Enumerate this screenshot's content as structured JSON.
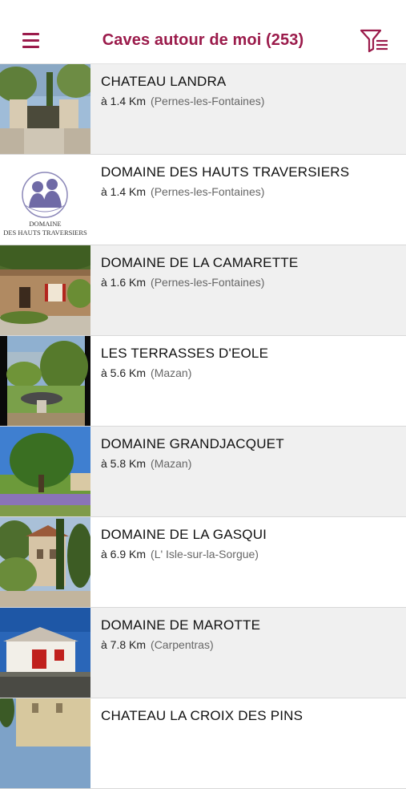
{
  "header": {
    "title": "Caves autour de moi (253)",
    "menu_icon": "hamburger-menu-icon",
    "filter_icon": "filter-list-icon",
    "accent_color": "#9b1b4b"
  },
  "wineries": [
    {
      "name": "CHATEAU LANDRA",
      "distance": "à 1.4 Km",
      "town": "(Pernes-les-Fontaines)",
      "thumb": "gate-photo"
    },
    {
      "name": "DOMAINE DES HAUTS TRAVERSIERS",
      "distance": "à 1.4 Km",
      "town": "(Pernes-les-Fontaines)",
      "thumb": "logo",
      "logo_line1": "DOMAINE",
      "logo_line2": "DES HAUTS TRAVERSIERS"
    },
    {
      "name": "DOMAINE DE LA CAMARETTE",
      "distance": "à 1.6 Km",
      "town": "(Pernes-les-Fontaines)",
      "thumb": "stone-house-photo"
    },
    {
      "name": "LES TERRASSES D'EOLE",
      "distance": "à 5.6 Km",
      "town": "(Mazan)",
      "thumb": "terrace-photo"
    },
    {
      "name": "DOMAINE GRANDJACQUET",
      "distance": "à 5.8 Km",
      "town": "(Mazan)",
      "thumb": "tree-photo"
    },
    {
      "name": "DOMAINE DE LA GASQUI",
      "distance": "à 6.9 Km",
      "town": "(L' Isle-sur-la-Sorgue)",
      "thumb": "cypress-photo"
    },
    {
      "name": "DOMAINE DE MAROTTE",
      "distance": "à 7.8 Km",
      "town": "(Carpentras)",
      "thumb": "red-door-photo"
    },
    {
      "name": "CHATEAU LA CROIX DES PINS",
      "distance": "",
      "town": "",
      "thumb": "facade-photo"
    }
  ]
}
